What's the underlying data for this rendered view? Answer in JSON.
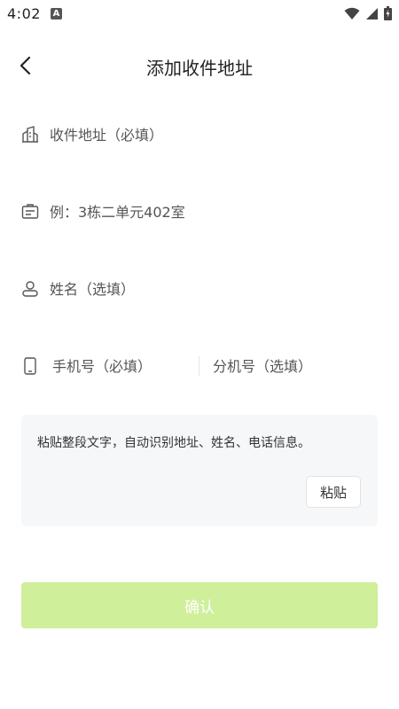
{
  "status_bar": {
    "time": "4:02",
    "notification_letter": "A",
    "icons": [
      "wifi-icon",
      "signal-icon",
      "battery-icon"
    ]
  },
  "nav": {
    "title": "添加收件地址",
    "back_icon": "chevron-left-icon"
  },
  "form": {
    "address": {
      "placeholder": "收件地址（必填）",
      "icon": "building-icon"
    },
    "detail": {
      "placeholder": "例：3栋二单元402室",
      "icon": "house-number-icon"
    },
    "name": {
      "placeholder": "姓名（选填）",
      "icon": "person-icon"
    },
    "phone": {
      "placeholder": "手机号（必填）",
      "icon": "phone-icon"
    },
    "extension": {
      "placeholder": "分机号（选填）"
    }
  },
  "paste": {
    "hint": "粘贴整段文字，自动识别地址、姓名、电话信息。",
    "button_label": "粘贴"
  },
  "confirm": {
    "label": "确认",
    "color": "#cfef9a"
  }
}
